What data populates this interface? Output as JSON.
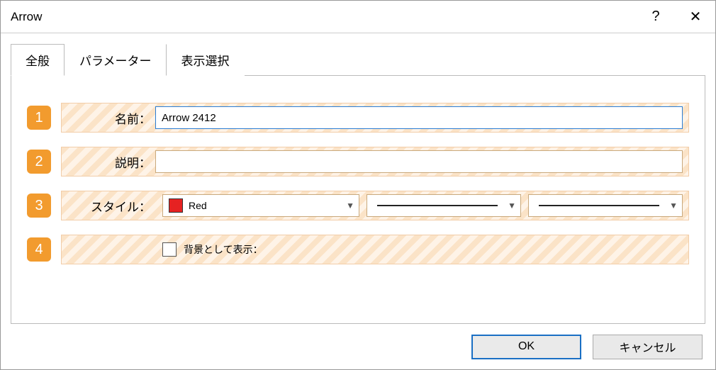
{
  "title": "Arrow",
  "tabs": {
    "general": "全般",
    "parameters": "パラメーター",
    "display": "表示選択"
  },
  "labels": {
    "name": "名前：",
    "description": "説明：",
    "style": "スタイル：",
    "showAsBackground": "背景として表示："
  },
  "badges": {
    "r1": "1",
    "r2": "2",
    "r3": "3",
    "r4": "4"
  },
  "values": {
    "name": "Arrow 2412",
    "description": "",
    "colorName": "Red",
    "colorHex": "#e62222"
  },
  "buttons": {
    "ok": "OK",
    "cancel": "キャンセル",
    "help": "?",
    "close": "✕"
  }
}
